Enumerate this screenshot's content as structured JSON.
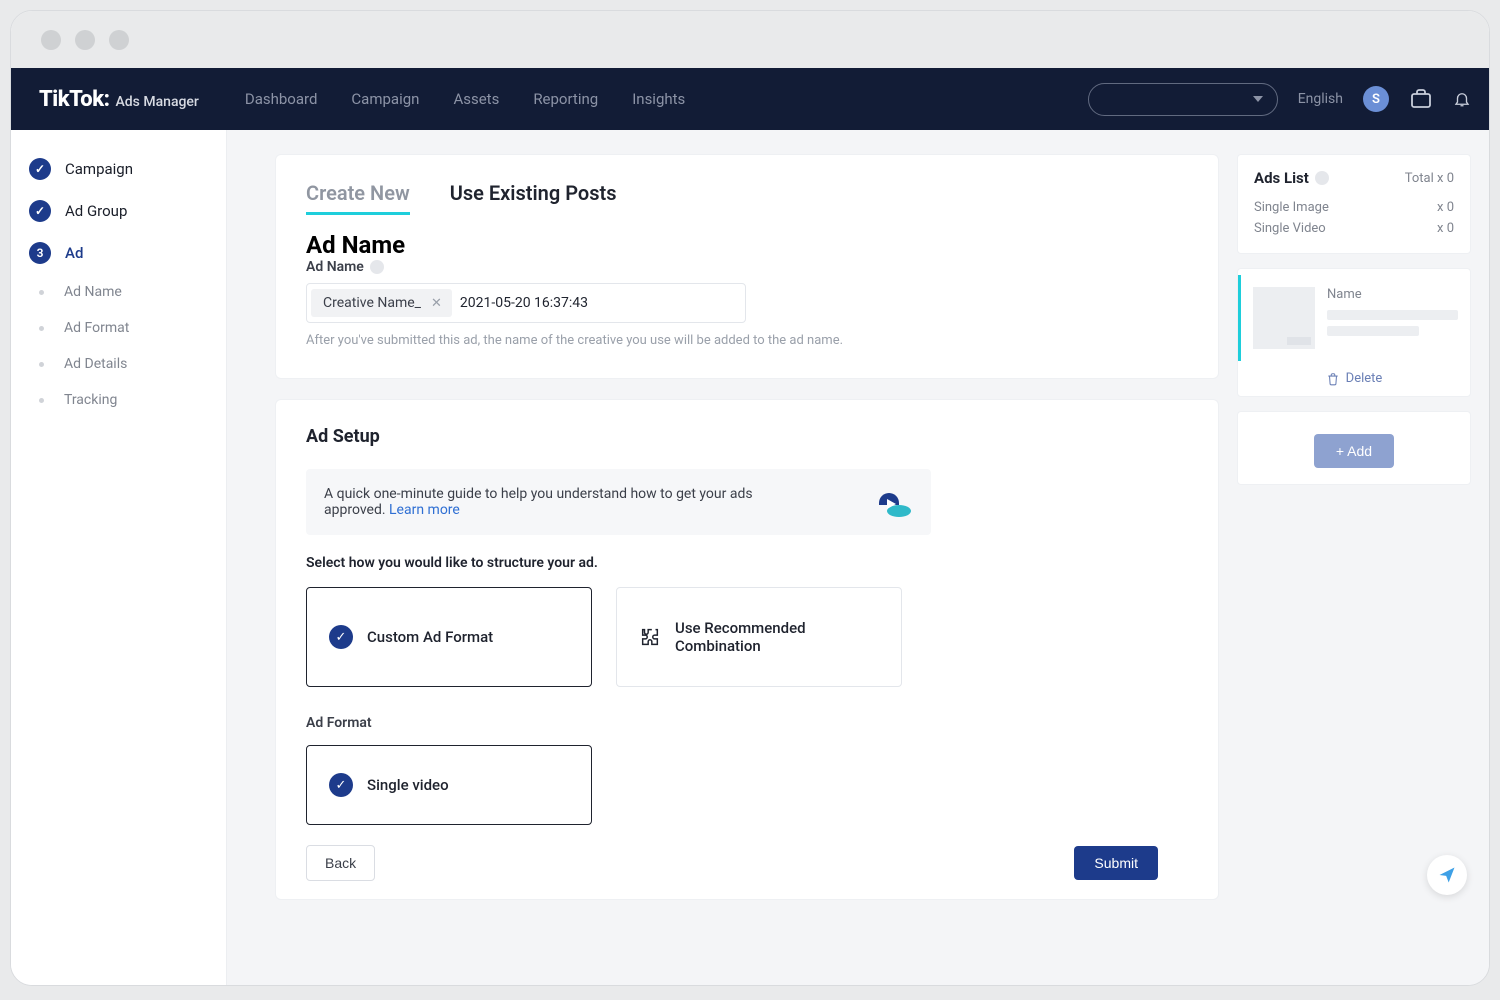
{
  "brand": {
    "main": "TikTok:",
    "sub": "Ads Manager"
  },
  "nav": {
    "items": [
      "Dashboard",
      "Campaign",
      "Assets",
      "Reporting",
      "Insights"
    ],
    "language": "English",
    "avatar_initial": "S"
  },
  "sidebar": {
    "steps": [
      {
        "label": "Campaign",
        "state": "done"
      },
      {
        "label": "Ad Group",
        "state": "done"
      },
      {
        "label": "Ad",
        "state": "current",
        "number": "3"
      }
    ],
    "subs": [
      "Ad Name",
      "Ad Format",
      "Ad Details",
      "Tracking"
    ]
  },
  "tabs": {
    "create": "Create New",
    "existing": "Use Existing Posts"
  },
  "ad_name": {
    "section_title": "Ad Name",
    "field_label": "Ad Name",
    "chip": "Creative Name_",
    "value": "2021-05-20 16:37:43",
    "hint": "After you've submitted this ad, the name of the creative you use will be added to the ad name."
  },
  "ad_setup": {
    "section_title": "Ad Setup",
    "guide_text": "A quick one-minute guide to help you understand how to get your ads approved. ",
    "guide_link": "Learn more",
    "select_label": "Select how you would like to structure your ad.",
    "option_custom": "Custom Ad Format",
    "option_recommended": "Use Recommended Combination",
    "format_label": "Ad Format",
    "format_value": "Single video"
  },
  "footer": {
    "back": "Back",
    "submit": "Submit"
  },
  "ads_list": {
    "title": "Ads List",
    "total_label": "Total x 0",
    "rows": [
      {
        "name": "Single Image",
        "count": "x 0"
      },
      {
        "name": "Single Video",
        "count": "x 0"
      }
    ],
    "thumb_label": "Name",
    "delete": "Delete",
    "add": "+ Add"
  }
}
